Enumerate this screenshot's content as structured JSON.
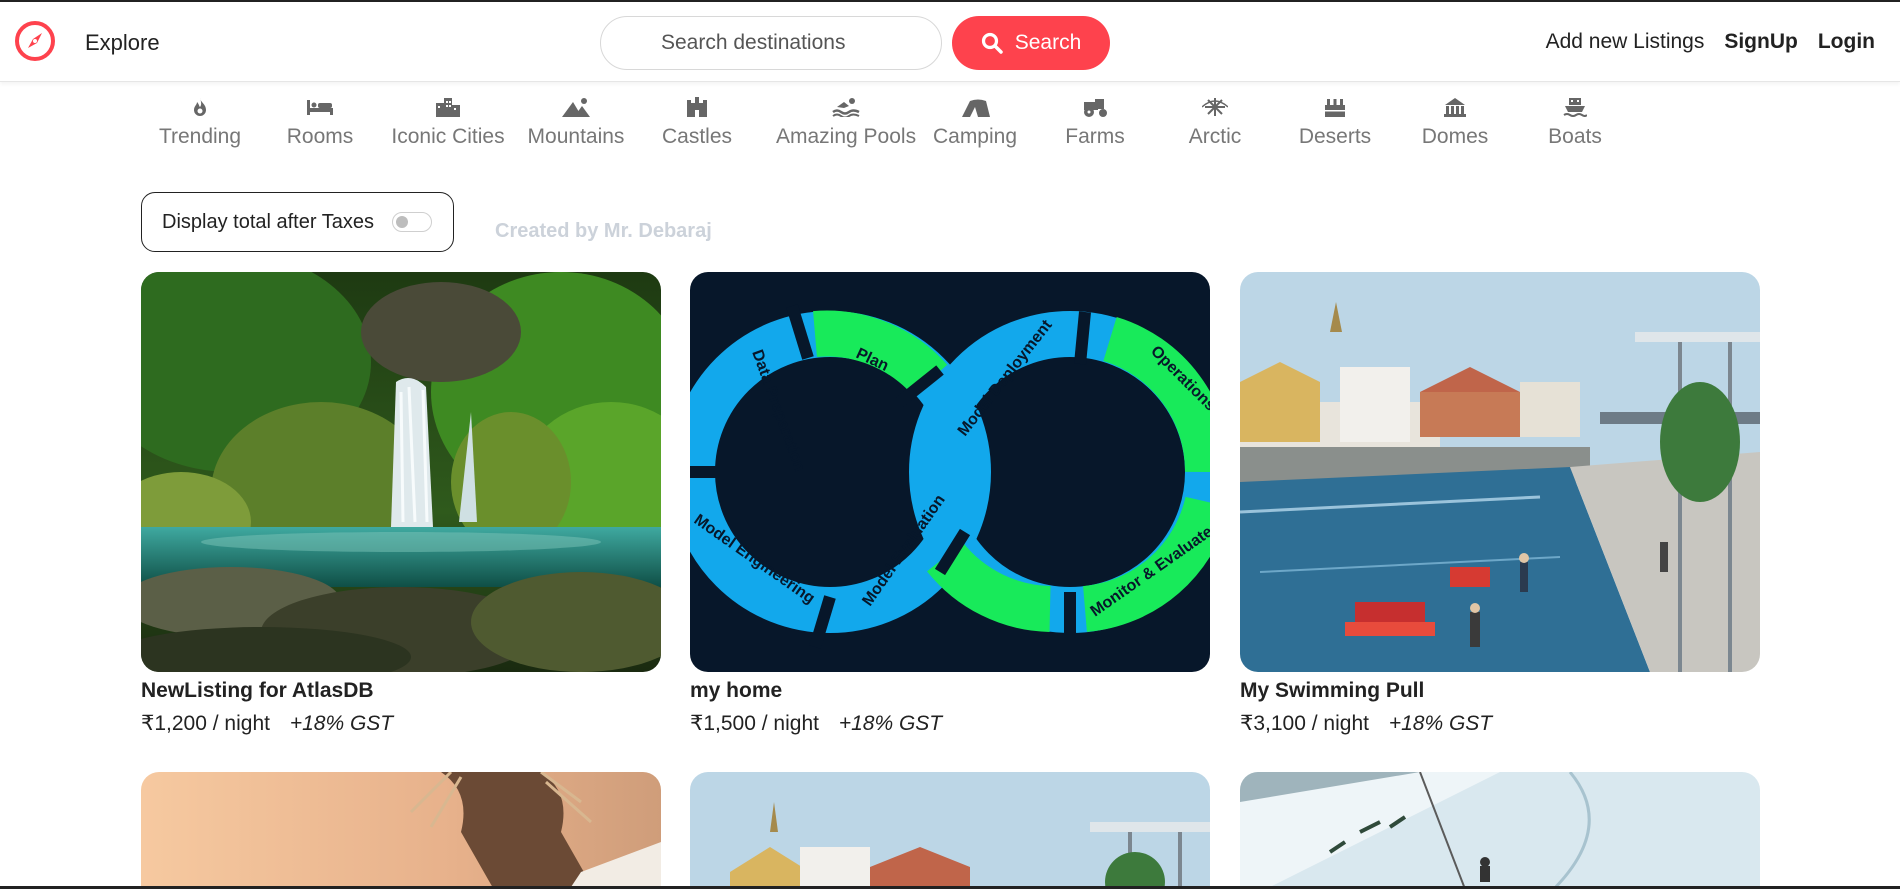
{
  "navbar": {
    "explore_label": "Explore",
    "search_placeholder": "Search destinations",
    "search_button_label": "Search",
    "add_listing_label": "Add new Listings",
    "signup_label": "SignUp",
    "login_label": "Login",
    "brand_color": "#fe424d"
  },
  "filters": [
    {
      "label": "Trending",
      "icon": "fire-icon"
    },
    {
      "label": "Rooms",
      "icon": "bed-icon"
    },
    {
      "label": "Iconic Cities",
      "icon": "city-icon"
    },
    {
      "label": "Mountains",
      "icon": "mountain-icon"
    },
    {
      "label": "Castles",
      "icon": "castle-icon"
    },
    {
      "label": "Amazing Pools",
      "icon": "swimmer-icon"
    },
    {
      "label": "Camping",
      "icon": "tent-icon"
    },
    {
      "label": "Farms",
      "icon": "tractor-icon"
    },
    {
      "label": "Arctic",
      "icon": "snowflake-icon"
    },
    {
      "label": "Deserts",
      "icon": "desert-icon"
    },
    {
      "label": "Domes",
      "icon": "dome-icon"
    },
    {
      "label": "Boats",
      "icon": "ship-icon"
    }
  ],
  "tax_toggle": {
    "label": "Display total after Taxes",
    "checked": false
  },
  "credit": "Created by Mr. Debaraj",
  "listings": [
    {
      "title": "NewListing for AtlasDB",
      "price": "₹1,200",
      "per": "/ night",
      "tax": "+18% GST"
    },
    {
      "title": "my home",
      "price": "₹1,500",
      "per": "/ night",
      "tax": "+18% GST"
    },
    {
      "title": "My Swimming Pull",
      "price": "₹3,100",
      "per": "/ night",
      "tax": "+18% GST"
    }
  ],
  "mlops_labels": [
    "Data Preparation",
    "Plan",
    "Model Deployment",
    "Operations",
    "Model Engineering",
    "Model Evaluation",
    "Monitor & Evaluate"
  ]
}
